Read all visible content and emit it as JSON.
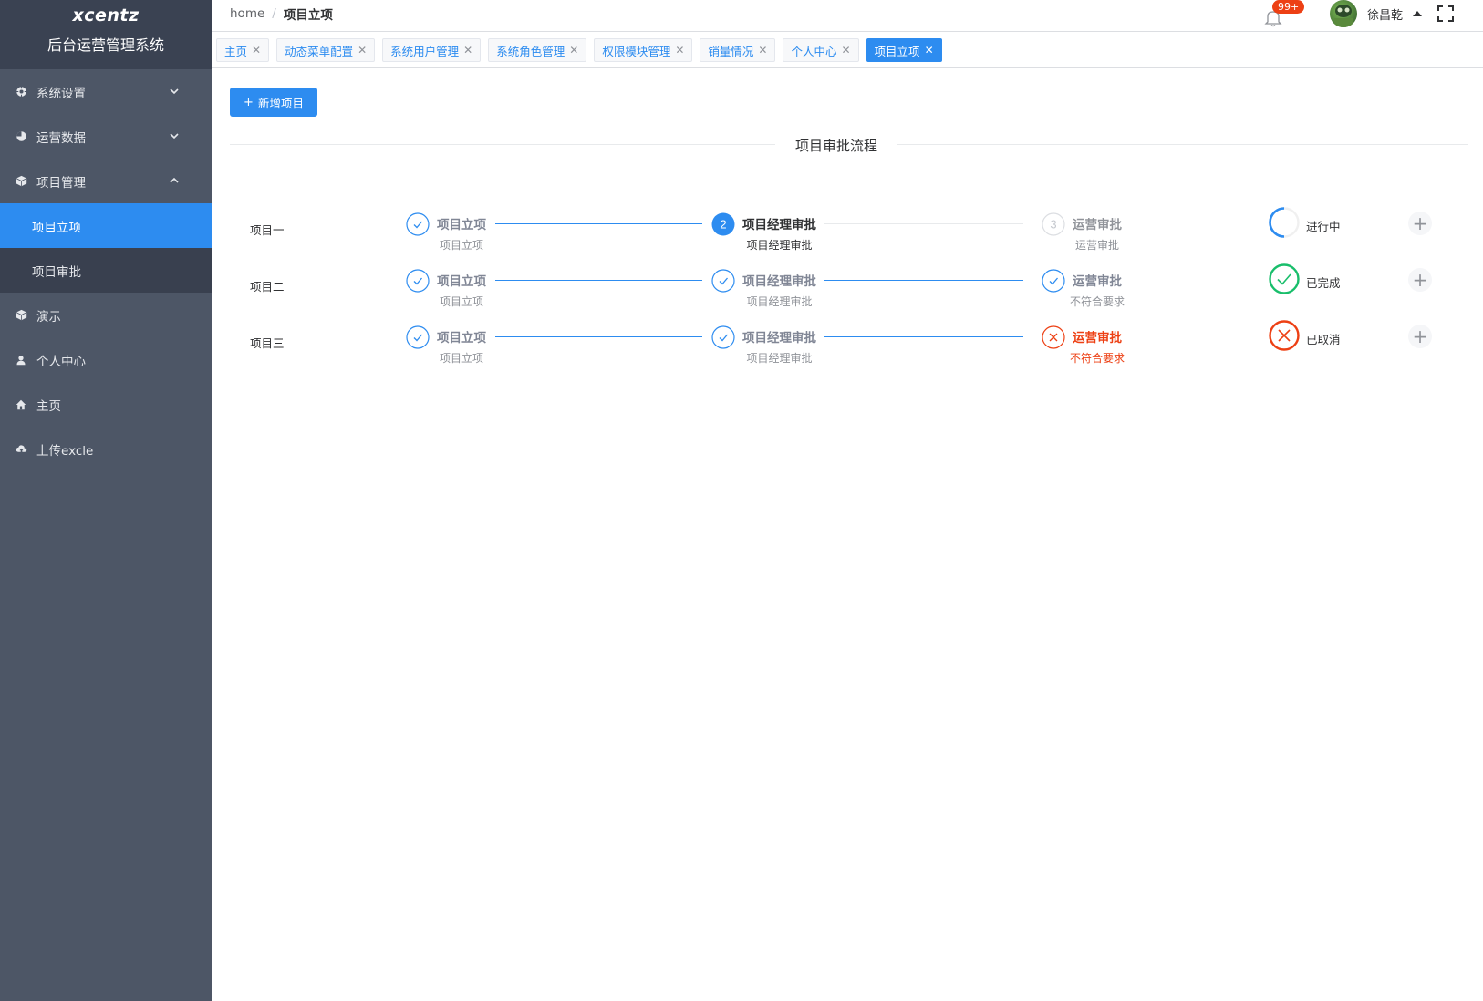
{
  "brand": {
    "logo": "xcentz",
    "system_name": "后台运营管理系统"
  },
  "sidebar": {
    "menus": [
      {
        "label": "系统设置",
        "icon": "gear-icon",
        "expanded": false
      },
      {
        "label": "运营数据",
        "icon": "pie-chart-icon",
        "expanded": false
      },
      {
        "label": "项目管理",
        "icon": "cube-icon",
        "expanded": true,
        "children": [
          {
            "label": "项目立项",
            "active": true
          },
          {
            "label": "项目审批",
            "active": false
          }
        ]
      },
      {
        "label": "演示",
        "icon": "cube-icon"
      },
      {
        "label": "个人中心",
        "icon": "person-icon"
      },
      {
        "label": "主页",
        "icon": "home-icon"
      },
      {
        "label": "上传excle",
        "icon": "cloud-upload-icon"
      }
    ]
  },
  "header": {
    "breadcrumb": {
      "home": "home",
      "current": "项目立项"
    },
    "notifications": "99+",
    "username": "徐昌乾"
  },
  "tags": [
    {
      "label": "主页",
      "active": false
    },
    {
      "label": "动态菜单配置",
      "active": false
    },
    {
      "label": "系统用户管理",
      "active": false
    },
    {
      "label": "系统角色管理",
      "active": false
    },
    {
      "label": "权限模块管理",
      "active": false
    },
    {
      "label": "销量情况",
      "active": false
    },
    {
      "label": "个人中心",
      "active": false
    },
    {
      "label": "项目立项",
      "active": true
    }
  ],
  "content": {
    "add_button": "新增项目",
    "section_title": "项目审批流程",
    "projects": [
      {
        "name": "项目一",
        "steps": [
          {
            "title": "项目立项",
            "desc": "项目立项",
            "state": "finish"
          },
          {
            "title": "项目经理审批",
            "desc": "项目经理审批",
            "state": "process",
            "number": "2"
          },
          {
            "title": "运营审批",
            "desc": "运营审批",
            "state": "wait",
            "number": "3"
          }
        ],
        "status": "进行中",
        "status_type": "progress",
        "status_color": "#2d8cf0"
      },
      {
        "name": "项目二",
        "steps": [
          {
            "title": "项目立项",
            "desc": "项目立项",
            "state": "finish"
          },
          {
            "title": "项目经理审批",
            "desc": "项目经理审批",
            "state": "finish"
          },
          {
            "title": "运营审批",
            "desc": "不符合要求",
            "state": "finish"
          }
        ],
        "status": "已完成",
        "status_type": "success",
        "status_color": "#19be6b"
      },
      {
        "name": "项目三",
        "steps": [
          {
            "title": "项目立项",
            "desc": "项目立项",
            "state": "finish"
          },
          {
            "title": "项目经理审批",
            "desc": "项目经理审批",
            "state": "finish"
          },
          {
            "title": "运营审批",
            "desc": "不符合要求",
            "state": "error"
          }
        ],
        "status": "已取消",
        "status_type": "error",
        "status_color": "#ed4014"
      }
    ]
  },
  "colors": {
    "primary": "#2d8cf0",
    "success": "#19be6b",
    "error": "#ed4014",
    "sidebar": "#4d5666"
  }
}
